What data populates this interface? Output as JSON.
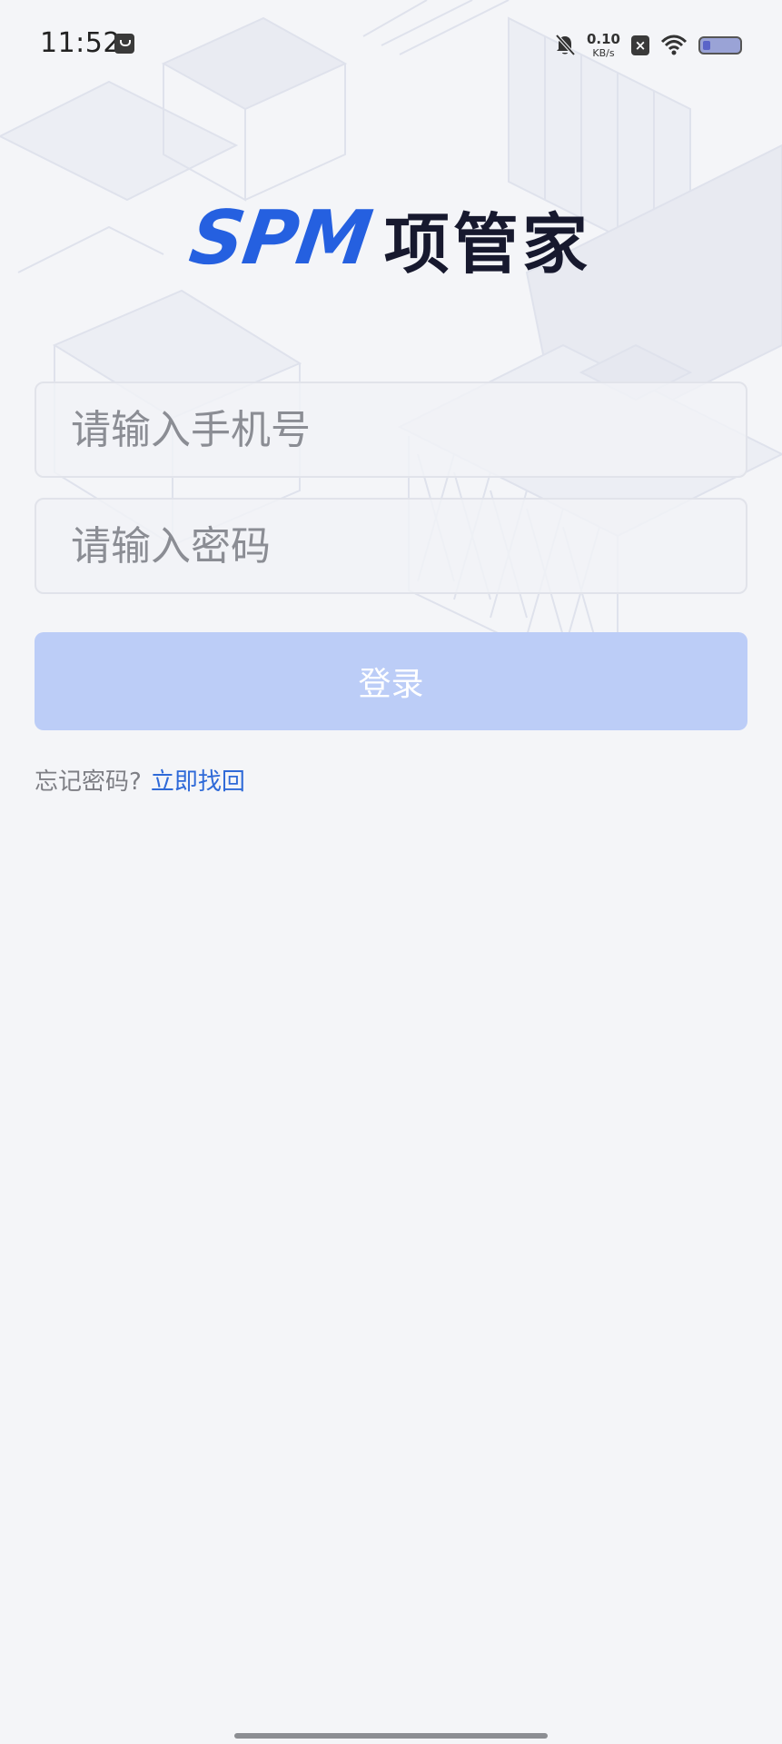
{
  "status_bar": {
    "time": "11:52",
    "net_speed_value": "0.10",
    "net_speed_unit": "KB/s",
    "battery_level": 0.2,
    "icons": [
      "app-notification-icon",
      "bell-muted-icon",
      "no-sim-icon",
      "wifi-icon",
      "battery-icon"
    ]
  },
  "logo": {
    "en": "SPM",
    "cn": "项管家",
    "colors": {
      "en": "#2560e0",
      "cn": "#17192e"
    }
  },
  "form": {
    "phone_placeholder": "请输入手机号",
    "password_placeholder": "请输入密码",
    "login_label": "登录"
  },
  "forgot": {
    "question": "忘记密码?",
    "link": "立即找回"
  },
  "colors": {
    "background": "#f4f5f8",
    "button": "#bccdf7",
    "link": "#2f6ad8"
  }
}
